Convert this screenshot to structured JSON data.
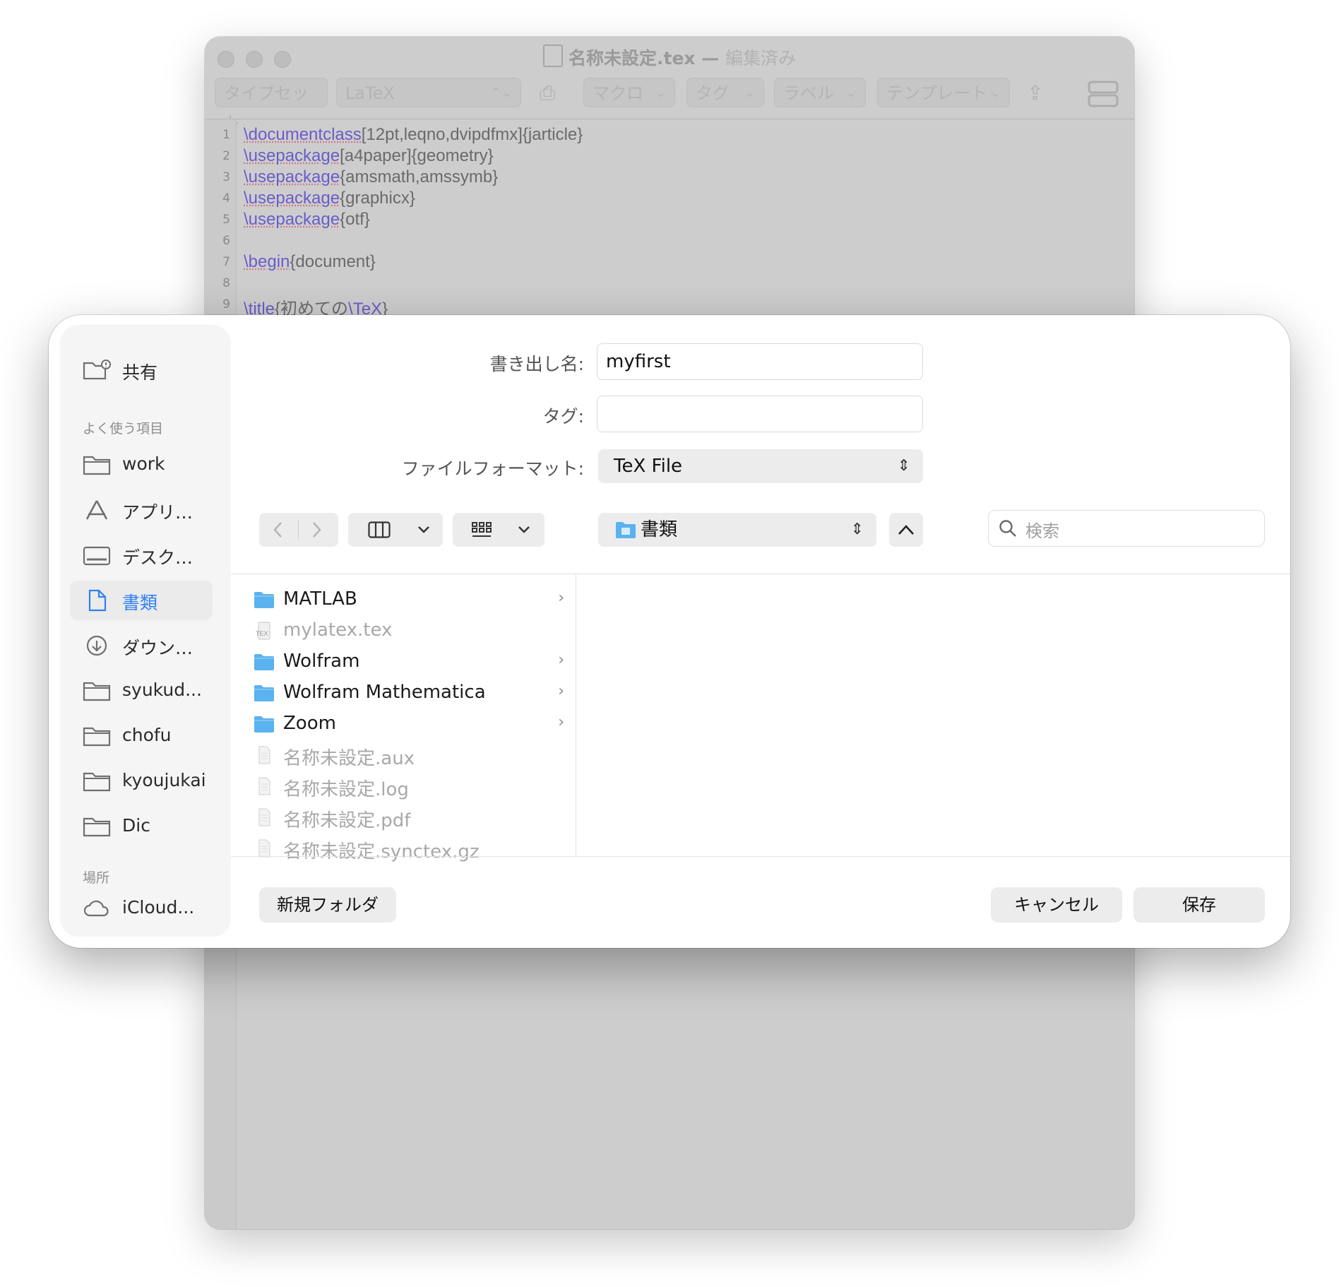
{
  "editor": {
    "title": "名称未設定.tex",
    "title_sep": " — ",
    "edited": "編集済み",
    "toolbar": {
      "typeset": "タイプセット",
      "engine": "LaTeX",
      "macro": "マクロ",
      "tag": "タグ",
      "label": "ラベル",
      "template": "テンプレート"
    },
    "lines": [
      {
        "no": "1",
        "kw": "\\documentclass",
        "rest": "[12pt,leqno,dvipdfmx]{jarticle}"
      },
      {
        "no": "2",
        "kw": "\\usepackage",
        "rest": "[a4paper]{geometry}"
      },
      {
        "no": "3",
        "kw": "\\usepackage",
        "rest": "{amsmath,amssymb}"
      },
      {
        "no": "4",
        "kw": "\\usepackage",
        "rest": "{graphicx}"
      },
      {
        "no": "5",
        "kw": "\\usepackage",
        "rest": "{otf}"
      },
      {
        "no": "6",
        "kw": "",
        "rest": ""
      },
      {
        "no": "7",
        "kw": "\\begin",
        "rest": "{document}"
      },
      {
        "no": "8",
        "kw": "",
        "rest": ""
      },
      {
        "no": "9",
        "kw": "\\title",
        "rest": "{初めての",
        "kw2": "\\TeX",
        "rest2": "}"
      }
    ]
  },
  "dialog": {
    "sidebar": {
      "shared": "共有",
      "favorites_header": "よく使う項目",
      "favorites": [
        "work",
        "アプリ…",
        "デスク…",
        "書類",
        "ダウン…",
        "syukud...",
        "chofu",
        "kyoujukai",
        "Dic"
      ],
      "locations_header": "場所",
      "locations": [
        "iCloud..."
      ]
    },
    "export_name_label": "書き出し名:",
    "export_name_value": "myfirst",
    "tags_label": "タグ:",
    "tags_value": "",
    "format_label": "ファイルフォーマット:",
    "format_value": "TeX File",
    "location_value": "書類",
    "search_placeholder": "検索",
    "files": [
      {
        "name": "MATLAB",
        "kind": "folder"
      },
      {
        "name": "mylatex.tex",
        "kind": "tex"
      },
      {
        "name": "Wolfram",
        "kind": "folder"
      },
      {
        "name": "Wolfram Mathematica",
        "kind": "folder"
      },
      {
        "name": "Zoom",
        "kind": "folder"
      },
      {
        "name": "名称未設定.aux",
        "kind": "doc"
      },
      {
        "name": "名称未設定.log",
        "kind": "doc"
      },
      {
        "name": "名称未設定.pdf",
        "kind": "doc"
      },
      {
        "name": "名称未設定.synctex.gz",
        "kind": "doc"
      }
    ],
    "new_folder": "新規フォルダ",
    "cancel": "キャンセル",
    "save": "保存"
  },
  "colors": {
    "accent": "#2f80f2",
    "folder": "#5ab2ee",
    "latex_command": "#6a5cc9"
  },
  "icons": {
    "nav_back": "chevron-left-icon",
    "nav_forward": "chevron-right-icon",
    "column_view": "column-view-icon",
    "grid_view": "grid-view-icon",
    "up": "chevron-up-icon",
    "search": "magnifier-icon"
  }
}
